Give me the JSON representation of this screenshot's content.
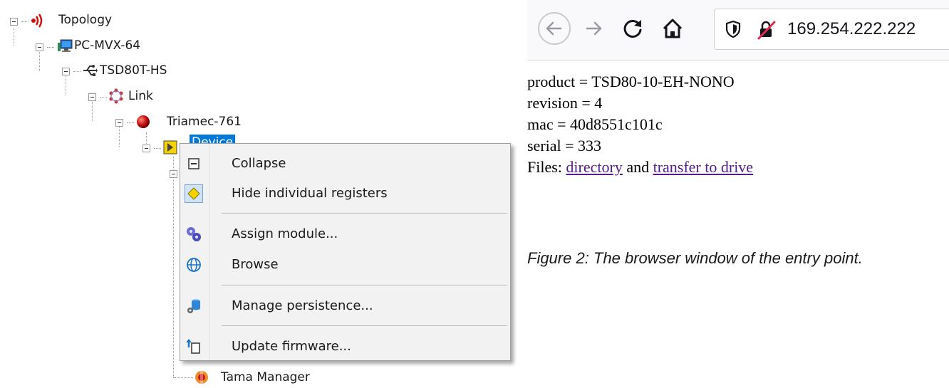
{
  "tree": {
    "nodes": [
      {
        "label": "Topology",
        "icon": "radio-waves-icon"
      },
      {
        "label": "PC-MVX-64",
        "icon": "computer-icon"
      },
      {
        "label": "TSD80T-HS",
        "icon": "usb-icon"
      },
      {
        "label": "Link",
        "icon": "link-ring-icon"
      },
      {
        "label": "Triamec-761",
        "icon": "red-ball-icon"
      },
      {
        "label": "Device",
        "icon": "device-yellow-icon",
        "selected": true
      },
      {
        "label": "Tama Manager",
        "icon": "tama-icon"
      }
    ]
  },
  "context_menu": {
    "items": [
      {
        "label": "Collapse",
        "icon": "collapse-icon"
      },
      {
        "label": "Hide individual registers",
        "icon": "register-diamond-icon"
      },
      {
        "label": "Assign module...",
        "icon": "gears-icon"
      },
      {
        "label": "Browse",
        "icon": "globe-icon"
      },
      {
        "label": "Manage persistence...",
        "icon": "database-gear-icon"
      },
      {
        "label": "Update firmware...",
        "icon": "firmware-upload-icon"
      }
    ]
  },
  "browser": {
    "url": "169.254.222.222",
    "page": {
      "product": "product = TSD80-10-EH-NONO",
      "revision": "revision = 4",
      "mac": "mac = 40d8551c101c",
      "serial": "serial = 333",
      "files_prefix": "Files:",
      "link_directory": "directory",
      "and_text": "and",
      "link_transfer": "transfer to drive"
    },
    "caption": "Figure 2: The browser window of the entry point."
  },
  "colors": {
    "selection": "#0078d7",
    "visited_link": "#551a8b",
    "menu_bg": "#f2f2f2"
  }
}
